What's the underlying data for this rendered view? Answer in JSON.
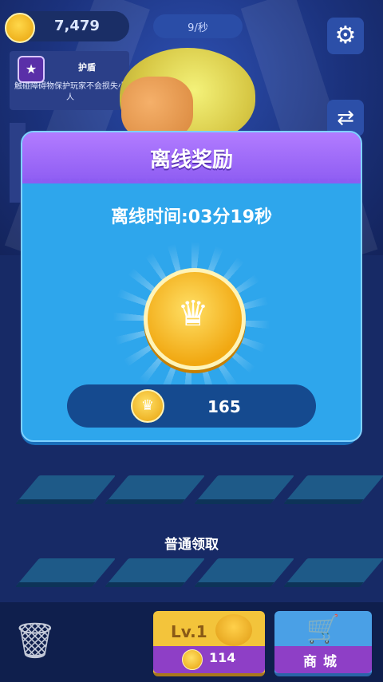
{
  "hud": {
    "coins": "7,479",
    "rate": "9/秒",
    "settings_icon": "gear-icon",
    "swap_icon": "swap-icon"
  },
  "shield": {
    "title": "护盾",
    "description": "触碰障碍物保护玩家不会损失小人"
  },
  "modal": {
    "title": "离线奖励",
    "offline_time": "离线时间:03分19秒",
    "reward_amount": "165"
  },
  "claim_label": "普通领取",
  "bottom": {
    "level_label": "Lv.1",
    "level_price": "114",
    "shop_label": "商城"
  },
  "colors": {
    "modal_body": "#2ea6ec",
    "modal_header": "#8d5cf2",
    "coin": "#f1a812"
  }
}
